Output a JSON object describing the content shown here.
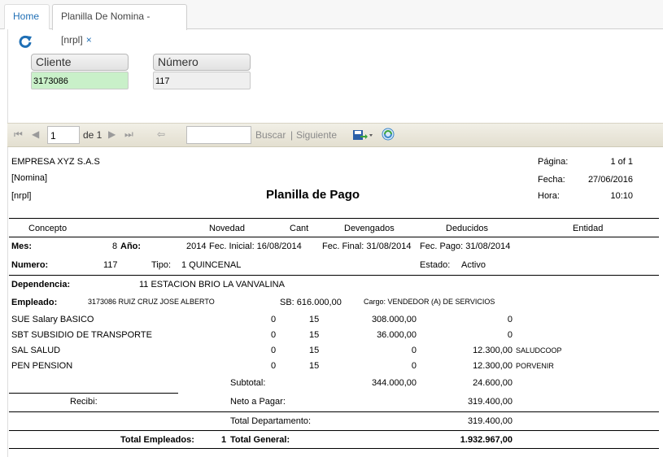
{
  "tabs": {
    "home": "Home",
    "active": "Planilla De Nomina -[nrpl]",
    "close": "×"
  },
  "fields": {
    "cliente": {
      "label": "Cliente",
      "value": "3173086"
    },
    "numero": {
      "label": "Número",
      "value": "117"
    }
  },
  "toolbar": {
    "page_value": "1",
    "of_text": "de 1",
    "search_value": "",
    "buscar": "Buscar",
    "separator": "|",
    "siguiente": "Siguiente"
  },
  "report": {
    "company": "EMPRESA XYZ S.A.S",
    "nomina": "[Nomina]",
    "code": "[nrpl]",
    "title": "Planilla de Pago",
    "pagina_label": "Página:",
    "pagina_value": "1 of 1",
    "fecha_label": "Fecha:",
    "fecha_value": "27/06/2016",
    "hora_label": "Hora:",
    "hora_value": "10:10",
    "columns": {
      "concepto": "Concepto",
      "novedad": "Novedad",
      "cant": "Cant",
      "devengados": "Devengados",
      "deducidos": "Deducidos",
      "entidad": "Entidad"
    },
    "mes_label": "Mes:",
    "mes_value": "8",
    "ano_label": "Año:",
    "ano_value": "2014",
    "fec_inicial": "Fec. Inicial: 16/08/2014",
    "fec_final": "Fec. Final: 31/08/2014",
    "fec_pago": "Fec. Pago: 31/08/2014",
    "numero_label": "Numero:",
    "numero_value": "117",
    "tipo_label": "Tipo:",
    "tipo_value": "1  QUINCENAL",
    "estado_label": "Estado:",
    "estado_value": "Activo",
    "dependencia_label": "Dependencia:",
    "dependencia_value": "11 ESTACION BRIO LA VANVALINA",
    "empleado_label": "Empleado:",
    "empleado_value": "3173086 RUIZ CRUZ JOSE ALBERTO",
    "sb": "SB: 616.000,00",
    "cargo": "Cargo: VENDEDOR (A) DE SERVICIOS",
    "lines": [
      {
        "concepto": "SUE Salary BASICO",
        "novedad": "0",
        "cant": "15",
        "devengados": "308.000,00",
        "deducidos": "0",
        "entidad": ""
      },
      {
        "concepto": "SBT SUBSIDIO DE TRANSPORTE",
        "novedad": "0",
        "cant": "15",
        "devengados": "36.000,00",
        "deducidos": "0",
        "entidad": ""
      },
      {
        "concepto": "SAL SALUD",
        "novedad": "0",
        "cant": "15",
        "devengados": "0",
        "deducidos": "12.300,00",
        "entidad": "SALUDCOOP"
      },
      {
        "concepto": "PEN PENSION",
        "novedad": "0",
        "cant": "15",
        "devengados": "0",
        "deducidos": "12.300,00",
        "entidad": "PORVENIR"
      }
    ],
    "subtotal_label": "Subtotal:",
    "subtotal_dev": "344.000,00",
    "subtotal_ded": "24.600,00",
    "recibi_label": "Recibi:",
    "neto_label": "Neto a Pagar:",
    "neto_value": "319.400,00",
    "total_depto_label": "Total Departamento:",
    "total_depto_value": "319.400,00",
    "total_empleados_label": "Total Empleados:",
    "total_empleados_value": "1",
    "total_general_label": "Total General:",
    "total_general_value": "1.932.967,00"
  },
  "colors": {
    "link": "#1f6fb5",
    "field_green": "#c9f0c9",
    "toolbar": "#e9e6da"
  }
}
